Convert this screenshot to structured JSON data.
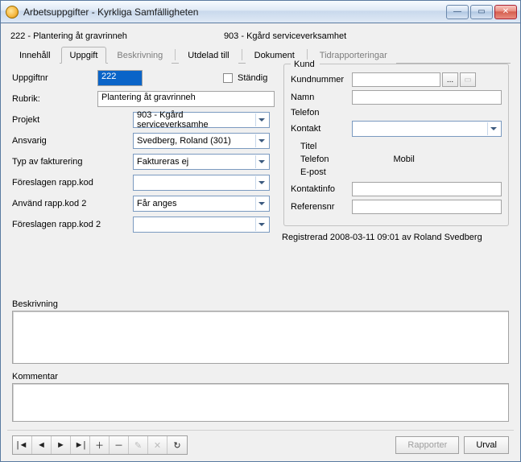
{
  "window": {
    "title": "Arbetsuppgifter - Kyrkliga Samfälligheten"
  },
  "breadcrumb": {
    "left": "222 - Plantering åt gravrinneh",
    "right": "903 - Kgård serviceverksamhet"
  },
  "tabs": {
    "innehall": "Innehåll",
    "uppgift": "Uppgift",
    "beskrivning": "Beskrivning",
    "utdelad": "Utdelad till",
    "dokument": "Dokument",
    "tidrapport": "Tidrapporteringar"
  },
  "labels": {
    "uppgiftnr": "Uppgiftnr",
    "standig": "Ständig",
    "rubrik": "Rubrik:",
    "projekt": "Projekt",
    "ansvarig": "Ansvarig",
    "fakturering": "Typ av fakturering",
    "foreslagen1": "Föreslagen rapp.kod",
    "anvand2": "Använd rapp.kod 2",
    "foreslagen2": "Föreslagen rapp.kod 2",
    "beskrivning_box": "Beskrivning",
    "kommentar_box": "Kommentar"
  },
  "values": {
    "uppgiftnr": "222",
    "rubrik": "Plantering åt gravrinneh",
    "projekt": "903 - Kgård serviceverksamhe",
    "ansvarig": "Svedberg, Roland (301)",
    "fakturering": "Faktureras ej",
    "foreslagen1": "",
    "anvand2": "Får anges",
    "foreslagen2": ""
  },
  "kund": {
    "legend": "Kund",
    "kundnummer": "Kundnummer",
    "namn": "Namn",
    "telefon": "Telefon",
    "kontakt": "Kontakt",
    "titel": "Titel",
    "ktelefon": "Telefon",
    "mobil": "Mobil",
    "epost": "E-post",
    "kontaktinfo": "Kontaktinfo",
    "referensnr": "Referensnr"
  },
  "registered": "Registrerad 2008-03-11 09:01 av Roland Svedberg",
  "buttons": {
    "rapporter": "Rapporter",
    "urval": "Urval"
  },
  "nav": {
    "first": "|◄",
    "prev": "◄",
    "next": "►",
    "last": "►|",
    "add": "＋",
    "del": "－",
    "edit": "✎",
    "cancel": "✕",
    "refresh": "↻"
  },
  "misc": {
    "ellipsis": "...",
    "doc": "▭"
  }
}
